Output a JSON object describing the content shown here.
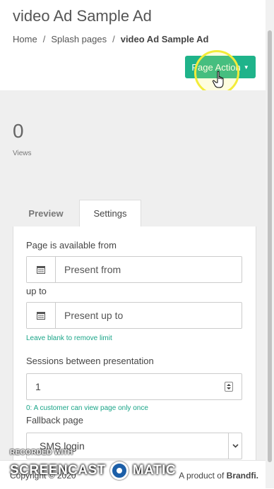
{
  "header": {
    "title": "video Ad Sample Ad",
    "breadcrumb": [
      "Home",
      "Splash pages",
      "video Ad Sample Ad"
    ],
    "action_button": "Page Action"
  },
  "stats": {
    "views_value": "0",
    "views_label": "Views"
  },
  "tabs": [
    {
      "label": "Preview",
      "active": false
    },
    {
      "label": "Settings",
      "active": true
    }
  ],
  "settings": {
    "available_from_label": "Page is available from",
    "present_from_placeholder": "Present from",
    "up_to_label": "up to",
    "present_up_to_placeholder": "Present up to",
    "blank_hint": "Leave blank to remove limit",
    "sessions_label": "Sessions between presentation",
    "sessions_value": "1",
    "sessions_hint": "0: A customer can view page only once",
    "fallback_label": "Fallback page",
    "fallback_value": "SMS login"
  },
  "footer": {
    "copyright": "Copyright © 2020",
    "product_prefix": "A product of ",
    "product_brand": "Brandfi."
  },
  "watermark": {
    "line1": "RECORDED WITH",
    "left": "SCREENCAST",
    "right": "MATIC"
  },
  "colors": {
    "primary": "#1fb38a",
    "hint": "#1aa588",
    "background": "#efefef",
    "highlight": "#f3ec3a"
  },
  "icons": [
    "calendar-icon",
    "caret-down-icon",
    "pointer-cursor-icon",
    "spinner-icon",
    "chevron-down-icon"
  ]
}
